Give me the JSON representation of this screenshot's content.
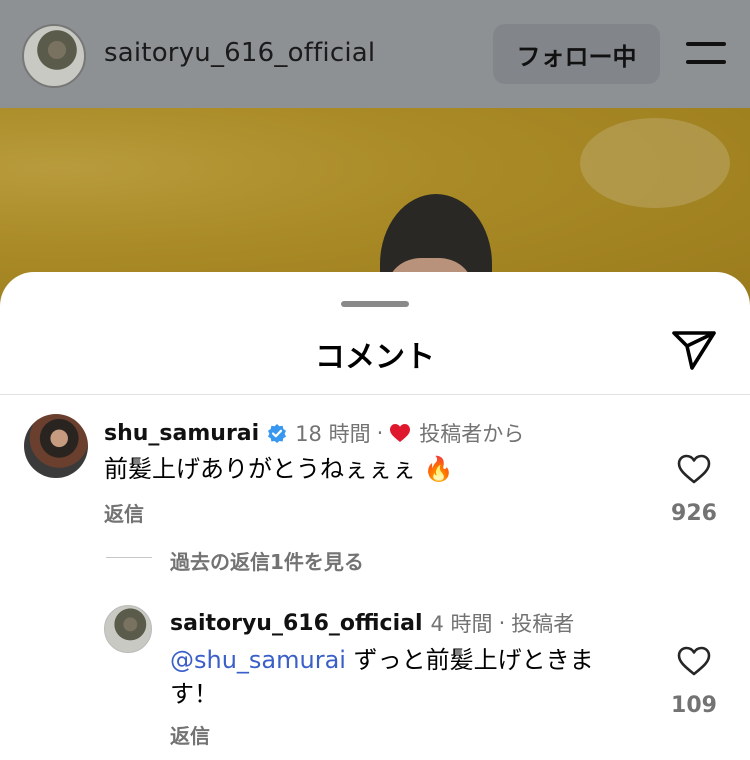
{
  "header": {
    "username": "saitoryu_616_official",
    "follow_label": "フォロー中"
  },
  "sheet": {
    "title": "コメント"
  },
  "comments": [
    {
      "username": "shu_samurai",
      "time": "18 時間",
      "separator": "·",
      "badge_text": "投稿者から",
      "text": "前髪上げありがとうねぇぇぇ 🔥",
      "reply_label": "返信",
      "like_count": "926",
      "view_replies": "過去の返信1件を見る"
    },
    {
      "username": "saitoryu_616_official",
      "time": "4 時間",
      "separator": "·",
      "badge_text": "投稿者",
      "mention": "@shu_samurai",
      "text_line1": " ずっと前髪上げときま",
      "text_line2": "す！",
      "reply_label": "返信",
      "like_count": "109"
    }
  ],
  "colors": {
    "mention": "#3a5fc8",
    "verified": "#3897f0",
    "heart": "#e0182d",
    "secondary_text": "#737373"
  }
}
